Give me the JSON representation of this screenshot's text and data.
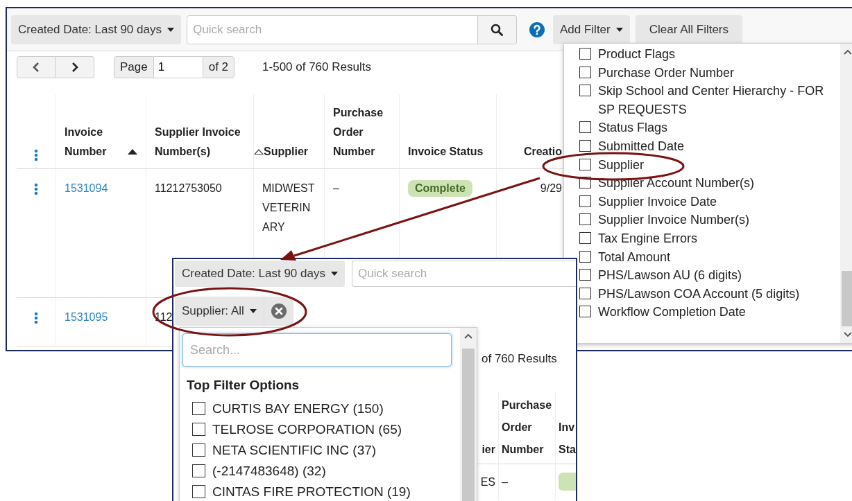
{
  "back_window": {
    "toolbar": {
      "date_filter": "Created Date: Last 90 days",
      "search": {
        "placeholder": "Quick search"
      },
      "add_filter": "Add Filter",
      "clear_filters": "Clear All Filters"
    },
    "pager": {
      "page_label": "Page",
      "page_value": "1",
      "page_total": "of 2",
      "results": "1-500 of 760 Results"
    },
    "table": {
      "columns": [
        {
          "label": "Invoice Number",
          "kind": "sorted"
        },
        {
          "label": "Supplier Invoice Number(s)",
          "kind": "plain"
        },
        {
          "label": "Supplier",
          "kind": "sortable"
        },
        {
          "label": "Purchase Order Number",
          "kind": "plain"
        },
        {
          "label": "Invoice Status",
          "kind": "plain"
        },
        {
          "label": "Creatio",
          "kind": "plain"
        }
      ],
      "rows": [
        {
          "cells": [
            {
              "kind": "link",
              "text": "1531094"
            },
            {
              "kind": "text",
              "text": "11212753050"
            },
            {
              "kind": "text",
              "text": "MIDWEST VETERINARY"
            },
            {
              "kind": "text",
              "text": "–"
            },
            {
              "kind": "badge",
              "text": "Complete"
            },
            {
              "kind": "date",
              "text": "9/29"
            }
          ]
        },
        {
          "cells": [
            {
              "kind": "link",
              "text": "1531095"
            },
            {
              "kind": "text",
              "text": "112"
            }
          ]
        }
      ]
    },
    "filter_menu": {
      "items": [
        {
          "label": "Product Flags",
          "checked": false
        },
        {
          "label": "Purchase Order Number",
          "checked": false
        },
        {
          "label": "Skip School and Center Hierarchy - FOR SP REQUESTS",
          "checked": false
        },
        {
          "label": "Status Flags",
          "checked": false
        },
        {
          "label": "Submitted Date",
          "checked": false
        },
        {
          "label": "Supplier",
          "checked": false
        },
        {
          "label": "Supplier Account Number(s)",
          "checked": false
        },
        {
          "label": "Supplier Invoice Date",
          "checked": false
        },
        {
          "label": "Supplier Invoice Number(s)",
          "checked": false
        },
        {
          "label": "Tax Engine Errors",
          "checked": false
        },
        {
          "label": "Total Amount",
          "checked": false
        },
        {
          "label": "PHS/Lawson AU (6 digits)",
          "checked": false
        },
        {
          "label": "PHS/Lawson COA Account (5 digits)",
          "checked": false
        },
        {
          "label": "Workflow Completion Date",
          "checked": false
        }
      ]
    }
  },
  "front_window": {
    "toolbar": {
      "date_filter": "Created Date: Last 90 days",
      "search": {
        "placeholder": "Quick search"
      }
    },
    "active_filters": [
      {
        "label": "Supplier: All"
      }
    ],
    "results": "of 760 Results",
    "columns": [
      "ier",
      "Purchase Order Number",
      "Inv Sta"
    ],
    "row": [
      "ES",
      "–"
    ],
    "supplier_dropdown": {
      "search": {
        "placeholder": "Search..."
      },
      "heading": "Top Filter Options",
      "options": [
        {
          "label": "CURTIS BAY ENERGY (150)",
          "checked": false
        },
        {
          "label": "TELROSE CORPORATION (65)",
          "checked": false
        },
        {
          "label": "NETA SCIENTIFIC INC (37)",
          "checked": false
        },
        {
          "label": "(-2147483648) (32)",
          "checked": false
        },
        {
          "label": "CINTAS FIRE PROTECTION (19)",
          "checked": false
        }
      ]
    }
  }
}
